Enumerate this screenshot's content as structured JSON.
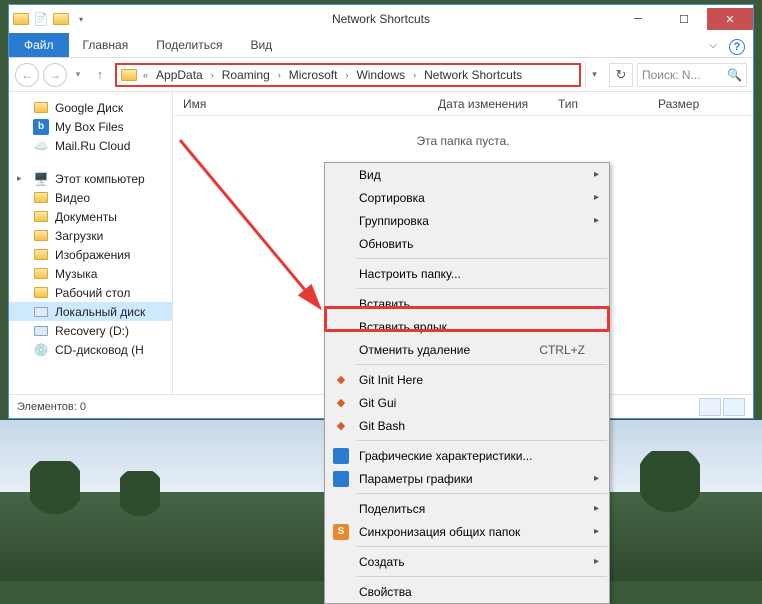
{
  "window": {
    "title": "Network Shortcuts"
  },
  "ribbon": {
    "file": "Файл",
    "tabs": [
      "Главная",
      "Поделиться",
      "Вид"
    ]
  },
  "address": {
    "crumbs": [
      "AppData",
      "Roaming",
      "Microsoft",
      "Windows",
      "Network Shortcuts"
    ]
  },
  "search": {
    "placeholder": "Поиск: N..."
  },
  "columns": {
    "name": "Имя",
    "date": "Дата изменения",
    "type": "Тип",
    "size": "Размер"
  },
  "empty_message": "Эта папка пуста.",
  "sidebar": {
    "fav": [
      {
        "label": "Google Диск",
        "icon": "folder"
      },
      {
        "label": "My Box Files",
        "icon": "box"
      },
      {
        "label": "Mail.Ru Cloud",
        "icon": "cloud"
      }
    ],
    "computer_label": "Этот компьютер",
    "computer": [
      {
        "label": "Видео",
        "icon": "folder"
      },
      {
        "label": "Документы",
        "icon": "folder"
      },
      {
        "label": "Загрузки",
        "icon": "folder"
      },
      {
        "label": "Изображения",
        "icon": "folder"
      },
      {
        "label": "Музыка",
        "icon": "folder"
      },
      {
        "label": "Рабочий стол",
        "icon": "folder"
      },
      {
        "label": "Локальный диск",
        "icon": "drive",
        "selected": true
      },
      {
        "label": "Recovery (D:)",
        "icon": "drive"
      },
      {
        "label": "CD-дисковод (H",
        "icon": "disc"
      }
    ]
  },
  "status": {
    "items": "Элементов: 0"
  },
  "ctx": {
    "items": [
      {
        "label": "Вид",
        "sub": true
      },
      {
        "label": "Сортировка",
        "sub": true
      },
      {
        "label": "Группировка",
        "sub": true
      },
      {
        "label": "Обновить"
      },
      {
        "sep": true
      },
      {
        "label": "Настроить папку..."
      },
      {
        "sep": true
      },
      {
        "label": "Вставить"
      },
      {
        "label": "Вставить ярлык",
        "highlight": true
      },
      {
        "label": "Отменить удаление",
        "shortcut": "CTRL+Z"
      },
      {
        "sep": true
      },
      {
        "label": "Git Init Here",
        "icon": "git"
      },
      {
        "label": "Git Gui",
        "icon": "git"
      },
      {
        "label": "Git Bash",
        "icon": "git"
      },
      {
        "sep": true
      },
      {
        "label": "Графические характеристики...",
        "icon": "intel"
      },
      {
        "label": "Параметры графики",
        "icon": "intel",
        "sub": true
      },
      {
        "sep": true
      },
      {
        "label": "Поделиться",
        "sub": true
      },
      {
        "label": "Синхронизация общих папок",
        "icon": "sync",
        "sub": true
      },
      {
        "sep": true
      },
      {
        "label": "Создать",
        "sub": true
      },
      {
        "sep": true
      },
      {
        "label": "Свойства"
      }
    ]
  }
}
